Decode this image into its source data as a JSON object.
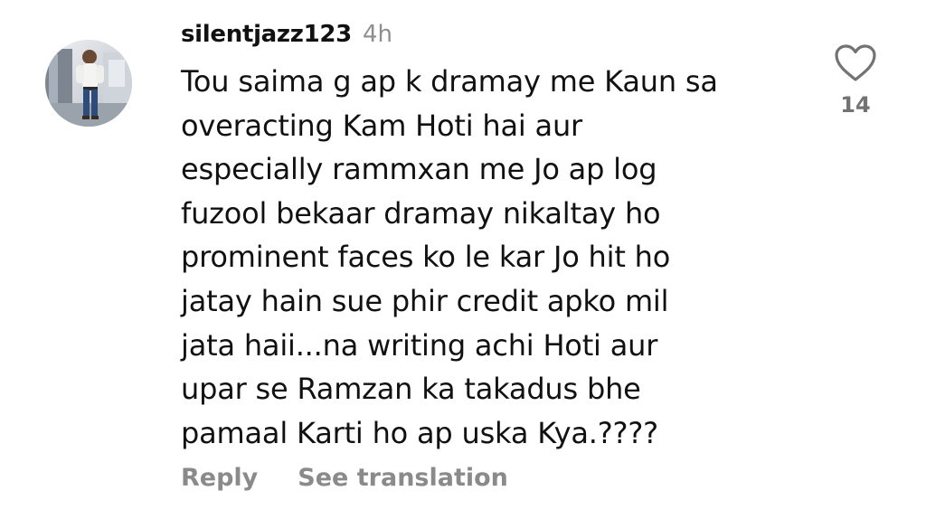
{
  "comment": {
    "username": "silentjazz123",
    "timestamp": "4h",
    "lines": [
      "Tou saima g ap k dramay me Kaun sa",
      "overacting Kam Hoti hai aur",
      "especially rammxan me Jo ap log",
      "fuzool bekaar dramay nikaltay ho",
      "prominent faces ko le kar Jo hit ho",
      "jatay hain sue phir credit apko mil",
      "jata haii...na writing achi Hoti aur",
      "upar se Ramzan ka takadus bhe",
      "pamaal Karti ho ap uska Kya.????"
    ],
    "like_count": "14",
    "like_icon": "heart-outline-icon"
  },
  "actions": {
    "reply_label": "Reply",
    "translate_label": "See translation"
  },
  "colors": {
    "text": "#111111",
    "muted": "#8e8e8e",
    "action": "#8a8a8a"
  }
}
